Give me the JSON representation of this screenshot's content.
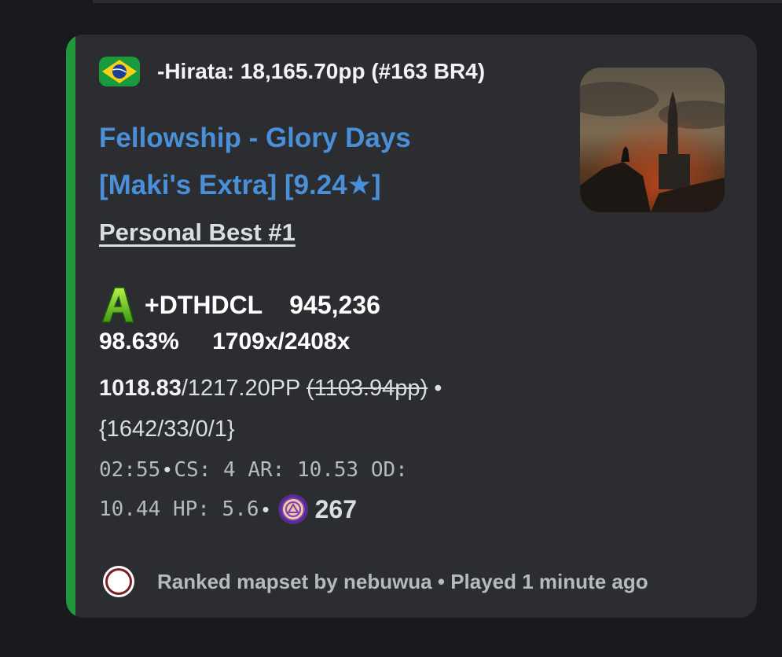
{
  "author": {
    "flag": "brazil-flag",
    "name": "-Hirata: 18,165.70pp (#163 BR4)"
  },
  "title": {
    "line1": "Fellowship - Glory Days",
    "line2": "[Maki's Extra] [9.24★]"
  },
  "thumbnail": "beatmap-cover-image",
  "personal_best": "Personal Best #1",
  "score": {
    "grade_icon": "grade-a-icon",
    "mods": "+DTHDCL",
    "total": "945,236",
    "accuracy": "98.63%",
    "combo": "1709x/2408x",
    "pp": "1018.83",
    "pp_max": "/1217.20PP",
    "pp_old": "(1103.94pp)",
    "bullet": "•",
    "hits": "{1642/33/0/1}"
  },
  "stats": {
    "length": "02:55",
    "cs": "CS: 4",
    "ar": "AR: 10.53",
    "od_label": "OD:",
    "od_value": "10.44",
    "hp": "HP: 5.6",
    "bullet": "•",
    "max_combo": "267",
    "max_combo_icon": "osu-combo-icon"
  },
  "footer": {
    "icon": "osu-ranked-icon",
    "text": "Ranked mapset by nebuwua • Played 1 minute ago"
  },
  "colors": {
    "accent": "#21963b",
    "link": "#4a90d9",
    "embed_bg": "#2b2d31",
    "page_bg": "#1a1a1e"
  }
}
